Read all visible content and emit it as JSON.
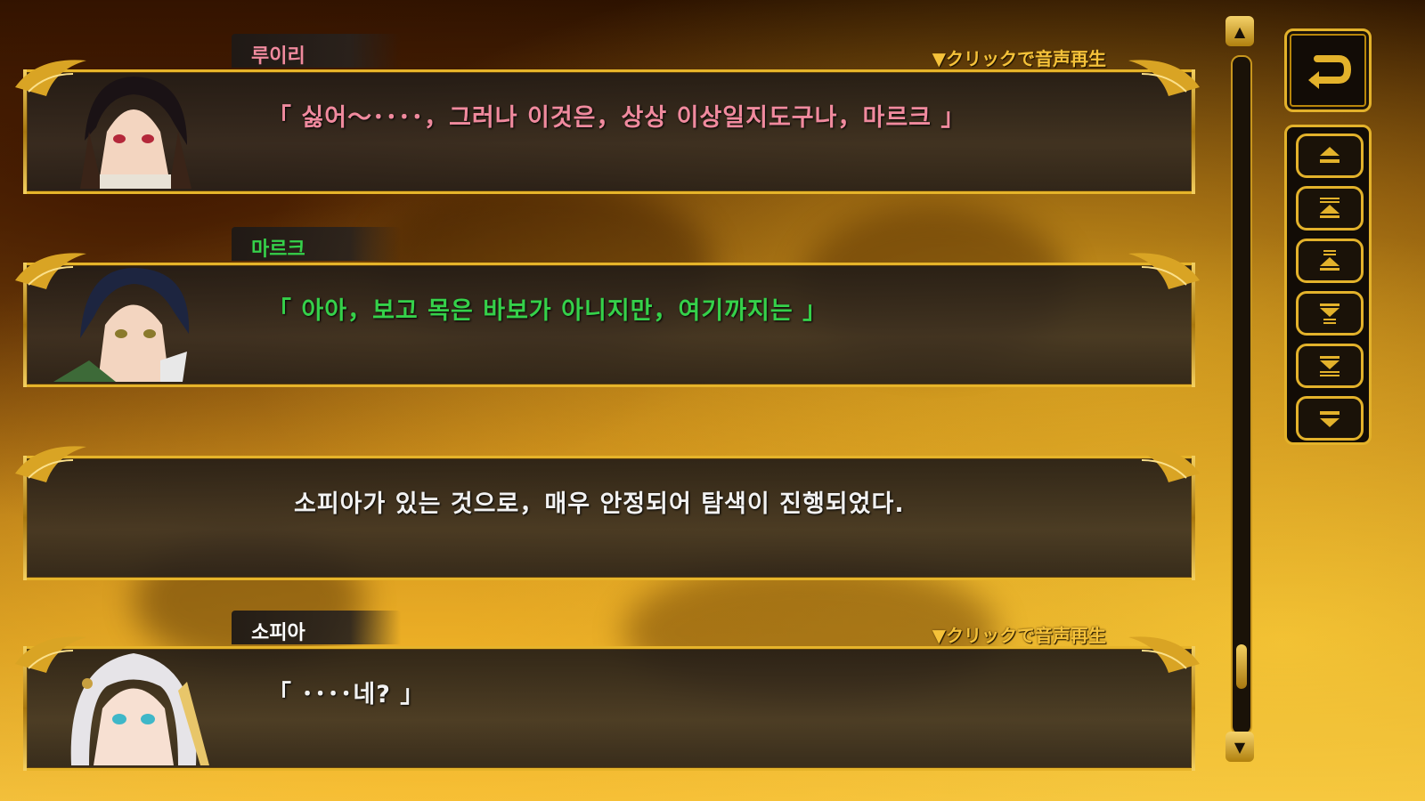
{
  "messages": [
    {
      "speaker": "루이리",
      "speaker_color": "#f08a9e",
      "text": "「 싫어～････，그러나 이것은，상상 이상일지도구나，마르크 」",
      "text_color": "#f08a9e",
      "voice_label": "▼クリックで音声再生",
      "has_avatar": true
    },
    {
      "speaker": "마르크",
      "speaker_color": "#35d14a",
      "text": "「 아아，보고 목은 바보가 아니지만，여기까지는 」",
      "text_color": "#35d14a",
      "voice_label": "",
      "has_avatar": true
    },
    {
      "speaker": "",
      "speaker_color": "#ffffff",
      "text": "소피아가 있는 것으로，매우 안정되어 탐색이 진행되었다.",
      "text_color": "#f2f2f2",
      "voice_label": "",
      "has_avatar": false
    },
    {
      "speaker": "소피아",
      "speaker_color": "#ffffff",
      "text": "「 ････네? 」",
      "text_color": "#f2f2f2",
      "voice_label": "▼クリックで音声再生",
      "has_avatar": true
    }
  ],
  "controls": {
    "back_icon": "return-arrow-icon",
    "nav_icons": [
      "scroll-top-icon",
      "page-up-icon",
      "line-up-icon",
      "line-down-icon",
      "page-down-icon",
      "scroll-bottom-icon"
    ]
  },
  "scrollbar": {
    "position_fraction": 0.92
  },
  "colors": {
    "accent_gold": "#e3b22b",
    "panel_dark": "#2a221b"
  }
}
